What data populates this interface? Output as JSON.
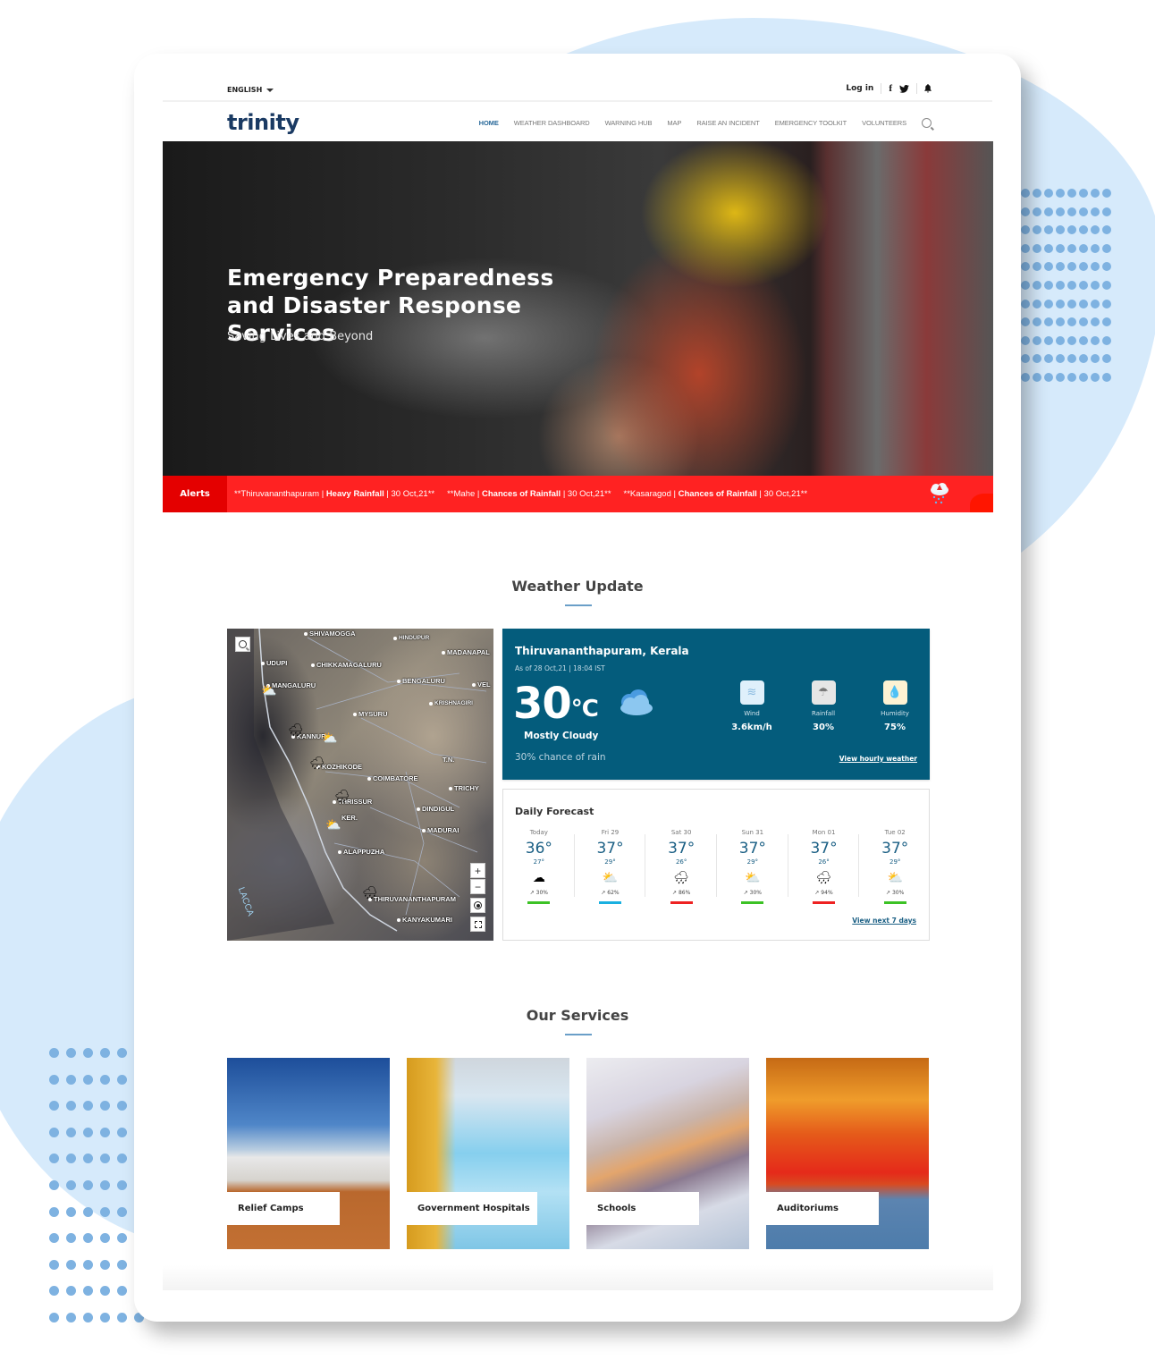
{
  "topbar": {
    "language": "ENGLISH",
    "login": "Log in",
    "social": {
      "facebook": "f",
      "twitter": "🐦"
    }
  },
  "brand": {
    "logo": "trinity"
  },
  "nav": {
    "items": [
      {
        "label": "HOME",
        "active": true
      },
      {
        "label": "WEATHER DASHBOARD",
        "active": false
      },
      {
        "label": "WARNING HUB",
        "active": false
      },
      {
        "label": "MAP",
        "active": false
      },
      {
        "label": "RAISE AN INCIDENT",
        "active": false
      },
      {
        "label": "EMERGENCY TOOLKIT",
        "active": false
      },
      {
        "label": "VOLUNTEERS",
        "active": false
      }
    ]
  },
  "hero": {
    "title": "Emergency Preparedness and Disaster Response Services",
    "subtitle": "Saving Lives and Beyond"
  },
  "alerts": {
    "label": "Alerts",
    "items": [
      {
        "prefix": "**Thiruvananthapuram | ",
        "type": "Heavy Rainfall",
        "suffix": " | 30 Oct,21**"
      },
      {
        "prefix": "**Mahe | ",
        "type": "Chances of Rainfall",
        "suffix": " | 30 Oct,21**"
      },
      {
        "prefix": "**Kasaragod | ",
        "type": "Chances of Rainfall",
        "suffix": " | 30 Oct,21**"
      }
    ]
  },
  "weather": {
    "section_title": "Weather Update",
    "map": {
      "labels": [
        "SHIVAMOGGA",
        "HINDUPUR",
        "MADANAPAL",
        "UDUPI",
        "CHIKKAMAGALURU",
        "MANGALURU",
        "BENGALURU",
        "VEL",
        "KRISHNAGIRI",
        "MYSURU",
        "KANNUR",
        "T.N.",
        "KOZHIKODE",
        "COIMBATORE",
        "TRICHY",
        "THRISSUR",
        "KER.",
        "DINDIGUL",
        "MADURAI",
        "ALAPPUZHA",
        "THIRUVANANTHAPURAM",
        "KANYAKUMARI",
        "LACCA"
      ],
      "zoom_in": "+",
      "zoom_out": "−"
    },
    "current": {
      "location": "Thiruvananthapuram, Kerala",
      "as_of": "As of 28 Oct,21 | 18:04 IST",
      "temp": "30",
      "unit": "°C",
      "condition": "Mostly Cloudy",
      "chance": "30% chance of rain",
      "stats": [
        {
          "label": "Wind",
          "value": "3.6km/h",
          "icon": "wind-icon",
          "color": "#dff0fb"
        },
        {
          "label": "Rainfall",
          "value": "30%",
          "icon": "rainfall-icon",
          "color": "#e6e6e6"
        },
        {
          "label": "Humidity",
          "value": "75%",
          "icon": "humidity-icon",
          "color": "#fdf2d3"
        }
      ],
      "link": "View hourly weather"
    },
    "daily": {
      "title": "Daily Forecast",
      "days": [
        {
          "name": "Today",
          "hi": "36°",
          "lo": "27°",
          "icon": "☁",
          "rain": "↗ 30%",
          "bar": "#3cc225"
        },
        {
          "name": "Fri 29",
          "hi": "37°",
          "lo": "29°",
          "icon": "⛅",
          "rain": "↗ 62%",
          "bar": "#19b0e0"
        },
        {
          "name": "Sat 30",
          "hi": "37°",
          "lo": "26°",
          "icon": "🌧",
          "rain": "↗ 86%",
          "bar": "#ee2222"
        },
        {
          "name": "Sun 31",
          "hi": "37°",
          "lo": "29°",
          "icon": "⛅",
          "rain": "↗ 30%",
          "bar": "#3cc225"
        },
        {
          "name": "Mon 01",
          "hi": "37°",
          "lo": "26°",
          "icon": "🌧",
          "rain": "↗ 94%",
          "bar": "#ee2222"
        },
        {
          "name": "Tue 02",
          "hi": "37°",
          "lo": "29°",
          "icon": "⛅",
          "rain": "↗ 30%",
          "bar": "#3cc225"
        }
      ],
      "link": "View next 7 days"
    }
  },
  "services": {
    "section_title": "Our Services",
    "items": [
      {
        "label": "Relief Camps"
      },
      {
        "label": "Government Hospitals"
      },
      {
        "label": "Schools"
      },
      {
        "label": "Auditoriums"
      }
    ]
  },
  "colors": {
    "brand": "#1a3a63",
    "accent": "#2a6a9a",
    "alert": "#ff2222",
    "weather_panel": "#045c7c"
  }
}
